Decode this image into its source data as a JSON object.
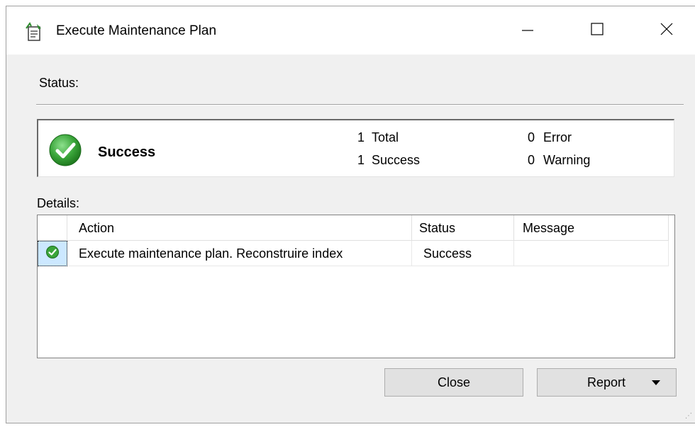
{
  "window": {
    "title": "Execute Maintenance Plan",
    "controls": {
      "minimize": "—",
      "maximize": "☐",
      "close": "✕"
    }
  },
  "status": {
    "label": "Status:",
    "result": "Success",
    "total_count": "1",
    "total_label": "Total",
    "success_count": "1",
    "success_label": "Success",
    "error_count": "0",
    "error_label": "Error",
    "warning_count": "0",
    "warning_label": "Warning"
  },
  "details": {
    "label": "Details:",
    "columns": [
      "Action",
      "Status",
      "Message"
    ],
    "rows": [
      {
        "action": "Execute maintenance plan. Reconstruire index",
        "status": "Success",
        "message": ""
      }
    ]
  },
  "buttons": {
    "close": "Close",
    "report": "Report"
  },
  "colors": {
    "success_green": "#3aa53a",
    "window_bg": "#f0f0f0",
    "button_bg": "#e1e1e1"
  },
  "icons": {
    "title": "maintenance-plan-icon",
    "result": "success-check-icon",
    "row": "row-success-icon",
    "dropdown": "dropdown-arrow-icon"
  }
}
